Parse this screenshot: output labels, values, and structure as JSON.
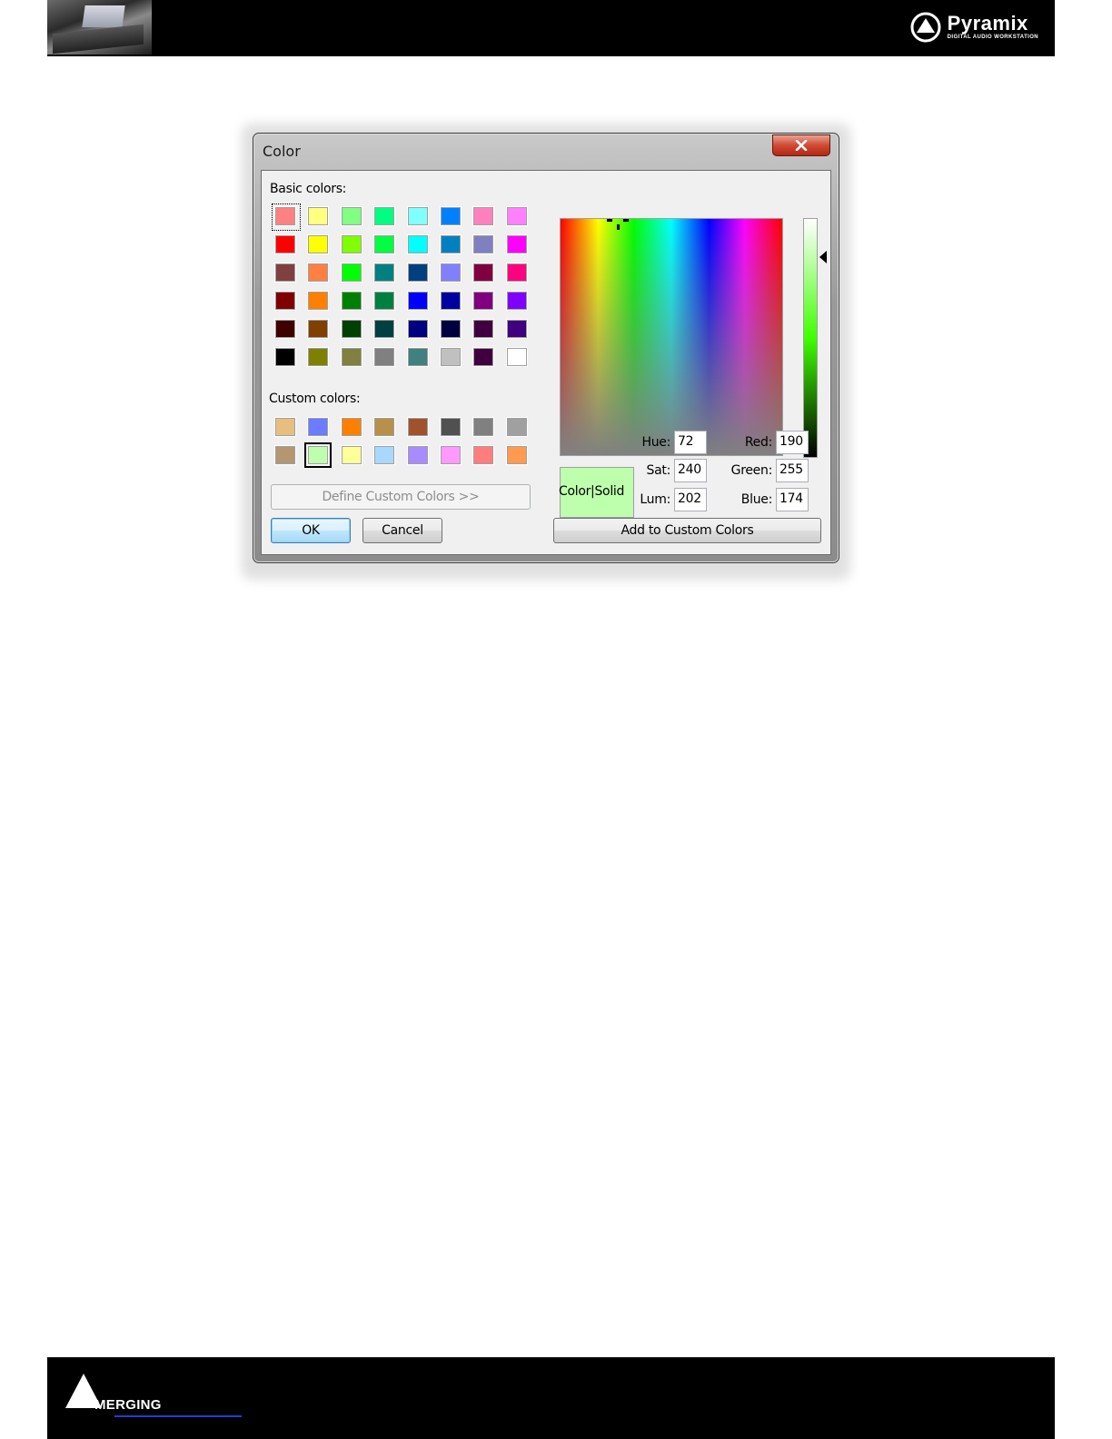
{
  "header": {
    "brand_name": "Pyramix",
    "brand_subtitle": "DIGITAL AUDIO WORKSTATION"
  },
  "footer": {
    "brand_name": "MERGING"
  },
  "dialog": {
    "title": "Color",
    "basic_colors_label": "Basic colors:",
    "custom_colors_label": "Custom colors:",
    "basic_colors": [
      [
        "#ff8080",
        "#ffff80",
        "#80ff80",
        "#00ff80",
        "#80ffff",
        "#0080ff",
        "#ff80c0",
        "#ff80ff"
      ],
      [
        "#ff0000",
        "#ffff00",
        "#80ff00",
        "#00ff40",
        "#00ffff",
        "#0080c0",
        "#8080c0",
        "#ff00ff"
      ],
      [
        "#804040",
        "#ff8040",
        "#00ff00",
        "#008080",
        "#004080",
        "#8080ff",
        "#800040",
        "#ff0080"
      ],
      [
        "#800000",
        "#ff8000",
        "#008000",
        "#008040",
        "#0000ff",
        "#0000a0",
        "#800080",
        "#8000ff"
      ],
      [
        "#400000",
        "#804000",
        "#004000",
        "#004040",
        "#000080",
        "#000040",
        "#400040",
        "#400080"
      ],
      [
        "#000000",
        "#808000",
        "#808040",
        "#808080",
        "#408080",
        "#c0c0c0",
        "#400040",
        "#ffffff"
      ]
    ],
    "custom_colors": [
      [
        "#e8be80",
        "#6a7cff",
        "#ff8000",
        "#b8904a",
        "#a0522d",
        "#505050",
        "#808080",
        "#a0a0a0"
      ],
      [
        "#b49670",
        "#beffae",
        "#ffff99",
        "#a8d8ff",
        "#a78bff",
        "#ff99ff",
        "#ff7d7d",
        "#ff9a50"
      ]
    ],
    "define_button_label": "Define Custom Colors >>",
    "ok_label": "OK",
    "cancel_label": "Cancel",
    "preview_label": "Color|Solid",
    "preview_color": "#beffae",
    "hue_label": "Hue:",
    "hue_value": "72",
    "sat_label": "Sat:",
    "sat_value": "240",
    "lum_label": "Lum:",
    "lum_value": "202",
    "red_label": "Red:",
    "red_value": "190",
    "green_label": "Green:",
    "green_value": "255",
    "blue_label": "Blue:",
    "blue_value": "174",
    "add_button_label": "Add to Custom Colors"
  }
}
